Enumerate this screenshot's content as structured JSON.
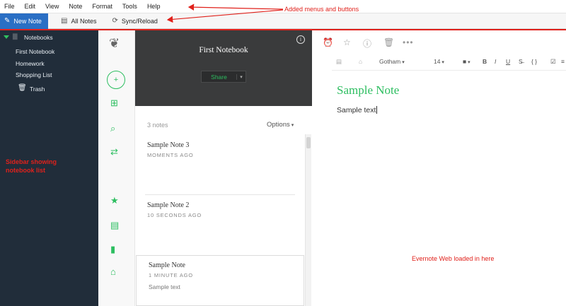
{
  "menubar": {
    "items": [
      "File",
      "Edit",
      "View",
      "Note",
      "Format",
      "Tools",
      "Help"
    ]
  },
  "toolbar": {
    "new_note": "New Note",
    "all_notes": "All Notes",
    "sync_reload": "Sync/Reload"
  },
  "sidebar": {
    "root": "Notebooks",
    "notebooks": [
      "First Notebook",
      "Homework",
      "Shopping List"
    ],
    "trash": "Trash"
  },
  "notebook_header": {
    "title": "First Notebook",
    "share_label": "Share"
  },
  "note_list": {
    "count": "3 notes",
    "options_label": "Options",
    "notes": [
      {
        "title": "Sample Note 3",
        "time": "MOMENTS AGO",
        "snippet": ""
      },
      {
        "title": "Sample Note 2",
        "time": "10 SECONDS AGO",
        "snippet": ""
      },
      {
        "title": "Sample Note",
        "time": "1 MINUTE AGO",
        "snippet": "Sample text"
      }
    ]
  },
  "editor": {
    "font_name": "Gotham",
    "font_size": "14",
    "bold": "B",
    "italic": "I",
    "underline": "U",
    "code": "{ }",
    "note_title": "Sample Note",
    "note_body": "Sample text"
  },
  "annotations": {
    "menus": "Added menus and buttons",
    "sidebar": "Sidebar showing notebook list",
    "web": "Evernote Web loaded in here"
  },
  "colors": {
    "accent_green": "#2dbe60",
    "sidebar_bg": "#212d3a",
    "annotation_red": "#e0211b",
    "toolbar_blue": "#2a6fc4"
  }
}
